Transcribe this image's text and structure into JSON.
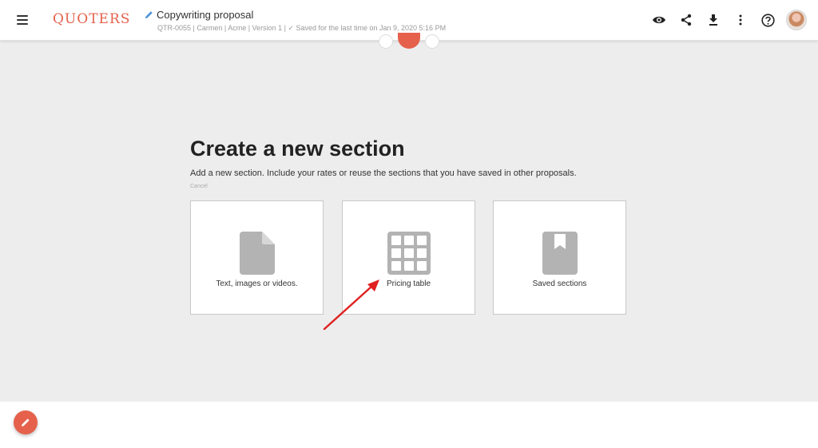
{
  "header": {
    "logo_text": "QUOTERS",
    "doc_title": "Copywriting proposal",
    "doc_meta": "QTR-0055 | Carmen | Acme | Version 1 | ✓ Saved for the last time on Jan 9, 2020 5:16 PM",
    "icons": [
      "preview-eye-icon",
      "share-icon",
      "download-icon",
      "more-vertical-icon",
      "help-icon",
      "user-avatar"
    ]
  },
  "section": {
    "heading": "Create a new section",
    "subtitle": "Add a new section. Include your rates or reuse the sections that you have saved in other proposals.",
    "cancel_label": "Cancel",
    "options": [
      {
        "label": "Text, images or videos.",
        "icon": "document-icon"
      },
      {
        "label": "Pricing table",
        "icon": "grid-table-icon"
      },
      {
        "label": "Saved sections",
        "icon": "bookmark-book-icon"
      }
    ]
  },
  "colors": {
    "accent": "#e5614c",
    "canvas_bg": "#ededed",
    "icon_gray": "#b3b3b3",
    "annotation_arrow": "#e02020"
  }
}
